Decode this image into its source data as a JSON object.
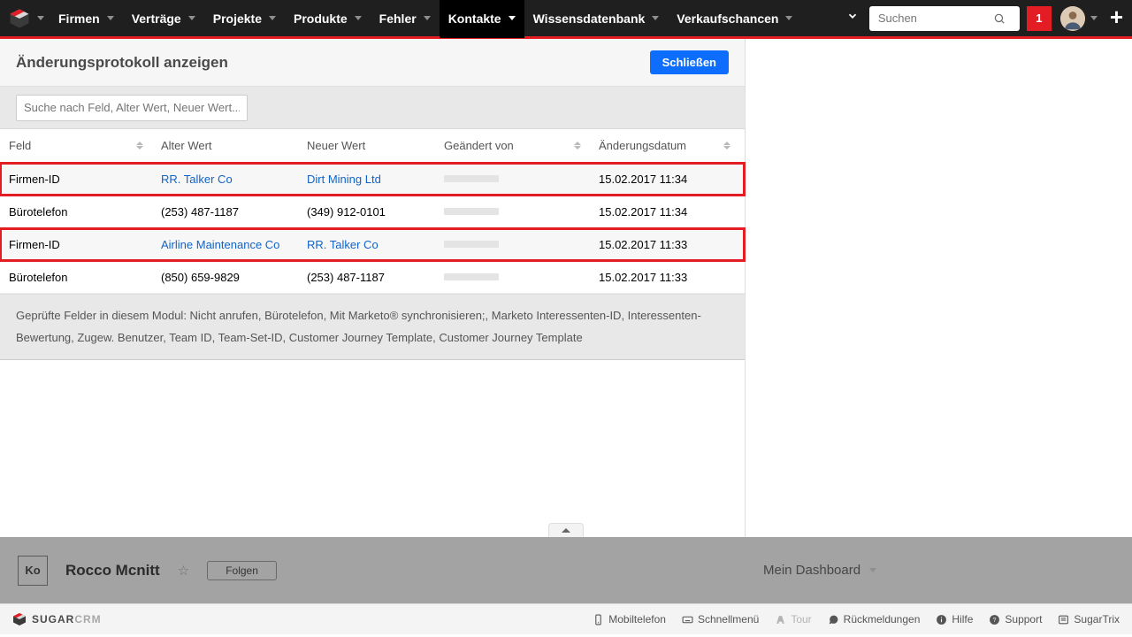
{
  "nav": {
    "items": [
      {
        "label": "Firmen"
      },
      {
        "label": "Verträge"
      },
      {
        "label": "Projekte"
      },
      {
        "label": "Produkte"
      },
      {
        "label": "Fehler"
      },
      {
        "label": "Kontakte"
      },
      {
        "label": "Wissensdatenbank"
      },
      {
        "label": "Verkaufschancen"
      }
    ],
    "active_index": 5,
    "search_placeholder": "Suchen",
    "notif_count": "1"
  },
  "panel": {
    "title": "Änderungsprotokoll anzeigen",
    "close_label": "Schließen",
    "filter_placeholder": "Suche nach Feld, Alter Wert, Neuer Wert..."
  },
  "columns": {
    "feld": "Feld",
    "alt": "Alter Wert",
    "neu": "Neuer Wert",
    "von": "Geändert von",
    "datum": "Änderungsdatum"
  },
  "rows": [
    {
      "feld": "Firmen-ID",
      "alt": "RR. Talker Co",
      "neu": "Dirt Mining Ltd",
      "datum": "15.02.2017 11:34",
      "link": true,
      "highlight": true
    },
    {
      "feld": "Bürotelefon",
      "alt": "(253) 487-1187",
      "neu": "(349) 912-0101",
      "datum": "15.02.2017 11:34",
      "link": false,
      "highlight": false
    },
    {
      "feld": "Firmen-ID",
      "alt": "Airline Maintenance Co",
      "neu": "RR. Talker Co",
      "datum": "15.02.2017 11:33",
      "link": true,
      "highlight": true
    },
    {
      "feld": "Bürotelefon",
      "alt": "(850) 659-9829",
      "neu": "(253) 487-1187",
      "datum": "15.02.2017 11:33",
      "link": false,
      "highlight": false
    }
  ],
  "audited_text": "Geprüfte Felder in diesem Modul: Nicht anrufen, Bürotelefon, Mit Marketo® synchronisieren;, Marketo Interessenten-ID, Interessenten-Bewertung, Zugew. Benutzer, Team ID, Team-Set-ID, Customer Journey Template, Customer Journey Template",
  "record": {
    "badge": "Ko",
    "name": "Rocco Mcnitt",
    "follow_label": "Folgen",
    "dashboard_label": "Mein Dashboard"
  },
  "footer": {
    "brand_a": "SUGAR",
    "brand_b": "CRM",
    "links": [
      {
        "label": "Mobiltelefon",
        "icon": "mobile"
      },
      {
        "label": "Schnellmenü",
        "icon": "keyboard"
      },
      {
        "label": "Tour",
        "icon": "road",
        "muted": true
      },
      {
        "label": "Rückmeldungen",
        "icon": "comment"
      },
      {
        "label": "Hilfe",
        "icon": "info"
      },
      {
        "label": "Support",
        "icon": "question"
      },
      {
        "label": "SugarTrix",
        "icon": "list"
      }
    ]
  }
}
